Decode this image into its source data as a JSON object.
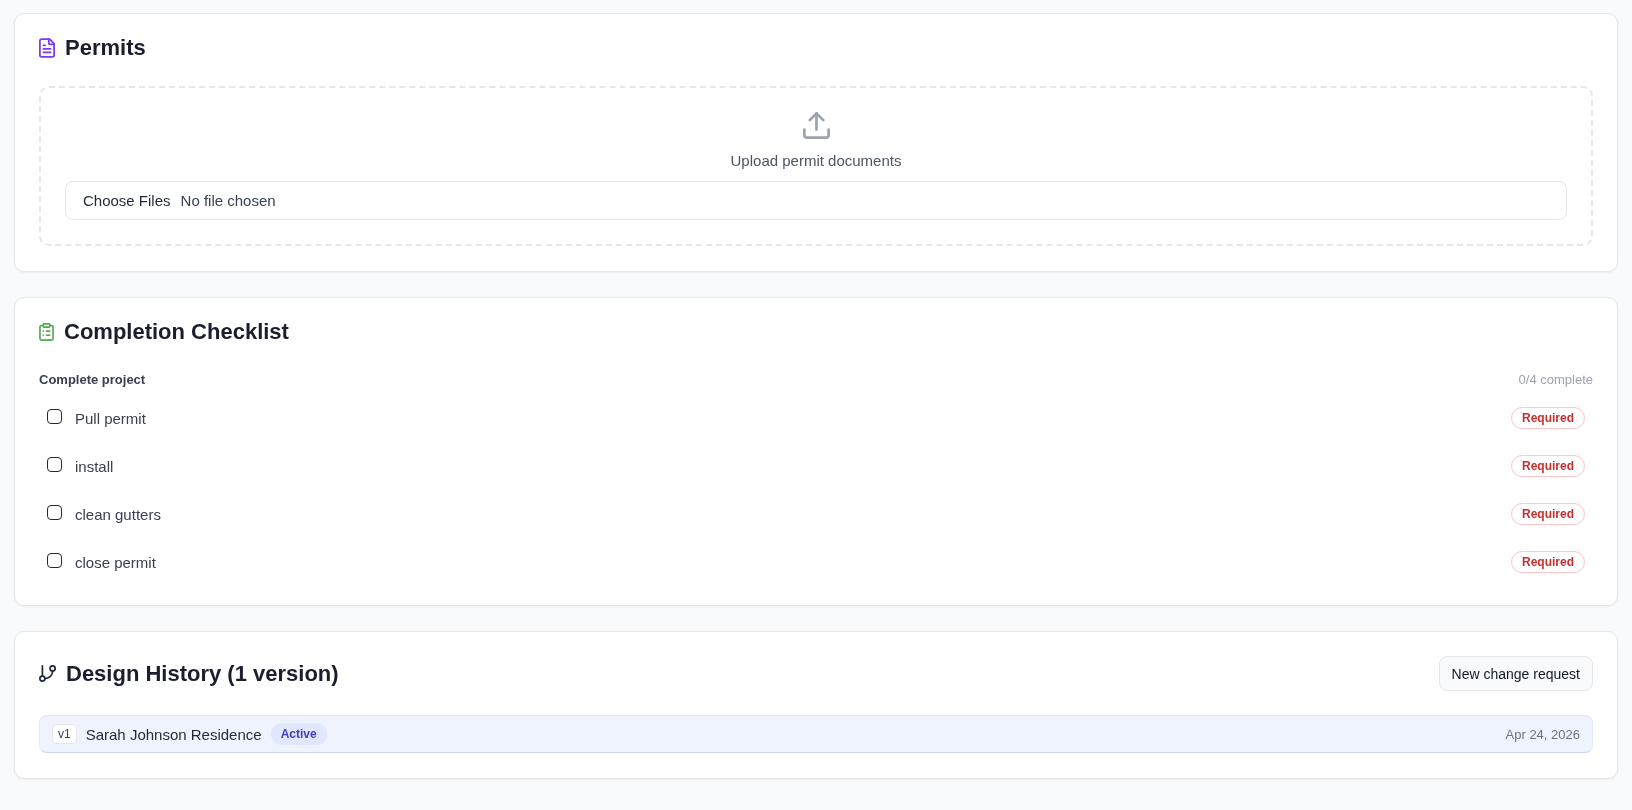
{
  "permits": {
    "title": "Permits",
    "upload": {
      "label": "Upload permit documents",
      "file_input": {
        "button": "Choose Files",
        "status_text": "No file chosen"
      }
    }
  },
  "checklist": {
    "title": "Completion Checklist",
    "group": {
      "name": "Complete project",
      "progress": "0/4 complete"
    },
    "items": [
      {
        "label": "Pull permit",
        "checked": false,
        "badge": "Required"
      },
      {
        "label": "install",
        "checked": false,
        "badge": "Required"
      },
      {
        "label": "clean gutters",
        "checked": false,
        "badge": "Required"
      },
      {
        "label": "close permit",
        "checked": false,
        "badge": "Required"
      }
    ]
  },
  "design_history": {
    "title": "Design History (1 version)",
    "action": "New change request",
    "versions": [
      {
        "version": "v1",
        "name": "Sarah Johnson Residence",
        "status": "Active",
        "date": "Apr 24, 2026",
        "selected": true
      }
    ]
  }
}
